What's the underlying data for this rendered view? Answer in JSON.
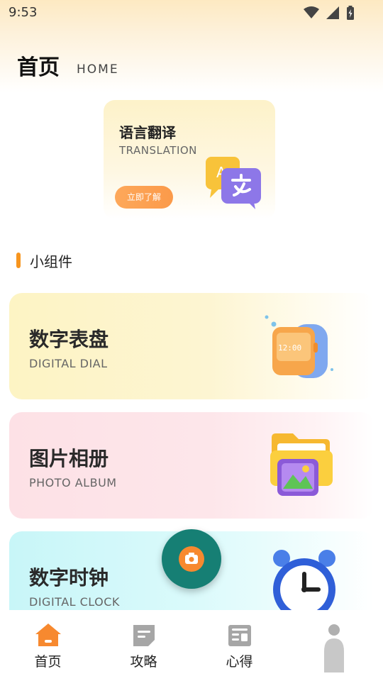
{
  "status_bar": {
    "time": "9:53"
  },
  "header": {
    "title": "首页",
    "subtitle": "HOME"
  },
  "banner": {
    "title": "语言翻译",
    "subtitle": "TRANSLATION",
    "button_label": "立即了解",
    "icon": "chat-bubbles-translation-icon"
  },
  "section": {
    "title": "小组件"
  },
  "cards": [
    {
      "title": "数字表盘",
      "subtitle": "DIGITAL DIAL",
      "icon": "smartwatch-icon",
      "watch_time": "12:00"
    },
    {
      "title": "图片相册",
      "subtitle": "PHOTO ALBUM",
      "icon": "photo-folder-icon"
    },
    {
      "title": "数字时钟",
      "subtitle": "DIGITAL CLOCK",
      "icon": "alarm-clock-icon"
    }
  ],
  "fab": {
    "icon": "camera-icon"
  },
  "bottom_nav": {
    "items": [
      {
        "label": "首页",
        "icon": "home-icon",
        "active": true
      },
      {
        "label": "攻略",
        "icon": "note-icon",
        "active": false
      },
      {
        "label": "心得",
        "icon": "article-icon",
        "active": false
      },
      {
        "label": "",
        "icon": "profile-icon",
        "active": false
      }
    ]
  },
  "colors": {
    "accent": "#f7951f",
    "fab": "#167f74",
    "nav_active": "#f7892f",
    "nav_inactive": "#9a9a9a"
  }
}
